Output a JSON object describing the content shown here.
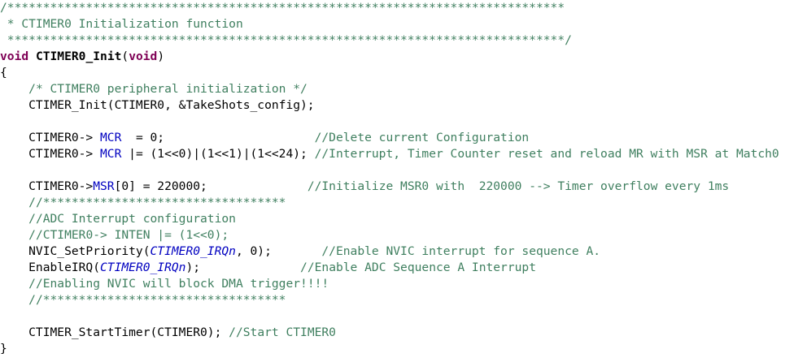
{
  "editor": {
    "lines": [
      {
        "name": "comment-header-top",
        "segments": [
          {
            "c": "cm",
            "t": "/******************************************************************************"
          }
        ]
      },
      {
        "name": "comment-header-title",
        "segments": [
          {
            "c": "cm",
            "t": " * CTIMER0 Initialization function"
          }
        ]
      },
      {
        "name": "comment-header-bottom",
        "segments": [
          {
            "c": "cm",
            "t": " ******************************************************************************/"
          }
        ]
      },
      {
        "name": "function-signature",
        "segments": [
          {
            "c": "kw",
            "t": "void"
          },
          {
            "c": "pl",
            "t": " "
          },
          {
            "c": "fnb",
            "t": "CTIMER0_Init"
          },
          {
            "c": "pl",
            "t": "("
          },
          {
            "c": "kw",
            "t": "void"
          },
          {
            "c": "pl",
            "t": ")"
          }
        ]
      },
      {
        "name": "open-brace",
        "segments": [
          {
            "c": "pl",
            "t": "{"
          }
        ]
      },
      {
        "name": "comment-peripheral-init",
        "segments": [
          {
            "c": "pl",
            "t": "    "
          },
          {
            "c": "cm",
            "t": "/* CTIMER0 peripheral initialization */"
          }
        ]
      },
      {
        "name": "ctimer-init-call",
        "segments": [
          {
            "c": "pl",
            "t": "    CTIMER_Init(CTIMER0, &TakeShots_config);"
          }
        ]
      },
      {
        "name": "blank-line",
        "segments": []
      },
      {
        "name": "mcr-clear",
        "segments": [
          {
            "c": "pl",
            "t": "    CTIMER0-> "
          },
          {
            "c": "fld",
            "t": "MCR"
          },
          {
            "c": "pl",
            "t": "  = 0;                     "
          },
          {
            "c": "cm",
            "t": "//Delete current Configuration"
          }
        ]
      },
      {
        "name": "mcr-set",
        "segments": [
          {
            "c": "pl",
            "t": "    CTIMER0-> "
          },
          {
            "c": "fld",
            "t": "MCR"
          },
          {
            "c": "pl",
            "t": " |= (1<<0)|(1<<1)|(1<<24); "
          },
          {
            "c": "cm",
            "t": "//Interrupt, Timer Counter reset and reload MR with MSR at Match0"
          }
        ]
      },
      {
        "name": "blank-line",
        "segments": []
      },
      {
        "name": "msr-set",
        "segments": [
          {
            "c": "pl",
            "t": "    CTIMER0->"
          },
          {
            "c": "fld",
            "t": "MSR"
          },
          {
            "c": "pl",
            "t": "[0] = 220000;              "
          },
          {
            "c": "cm",
            "t": "//Initialize MSR0 with  220000 --> Timer overflow every 1ms"
          }
        ]
      },
      {
        "name": "comment-separator",
        "segments": [
          {
            "c": "pl",
            "t": "    "
          },
          {
            "c": "cm",
            "t": "//**********************************"
          }
        ]
      },
      {
        "name": "comment-adc-interrupt",
        "segments": [
          {
            "c": "pl",
            "t": "    "
          },
          {
            "c": "cm",
            "t": "//ADC Interrupt configuration"
          }
        ]
      },
      {
        "name": "comment-inten",
        "segments": [
          {
            "c": "pl",
            "t": "    "
          },
          {
            "c": "cm",
            "t": "//CTIMER0-> INTEN |= (1<<0);"
          }
        ]
      },
      {
        "name": "nvic-set-priority",
        "segments": [
          {
            "c": "pl",
            "t": "    NVIC_SetPriority("
          },
          {
            "c": "it",
            "t": "CTIMER0_IRQn"
          },
          {
            "c": "pl",
            "t": ", 0);       "
          },
          {
            "c": "cm",
            "t": "//Enable NVIC interrupt for sequence A."
          }
        ]
      },
      {
        "name": "enable-irq",
        "segments": [
          {
            "c": "pl",
            "t": "    EnableIRQ("
          },
          {
            "c": "it",
            "t": "CTIMER0_IRQn"
          },
          {
            "c": "pl",
            "t": ");              "
          },
          {
            "c": "cm",
            "t": "//Enable ADC Sequence A Interrupt"
          }
        ]
      },
      {
        "name": "comment-nvic-dma",
        "segments": [
          {
            "c": "pl",
            "t": "    "
          },
          {
            "c": "cm",
            "t": "//Enabling NVIC will block DMA trigger!!!!"
          }
        ]
      },
      {
        "name": "comment-separator",
        "segments": [
          {
            "c": "pl",
            "t": "    "
          },
          {
            "c": "cm",
            "t": "//**********************************"
          }
        ]
      },
      {
        "name": "blank-line",
        "segments": []
      },
      {
        "name": "start-timer",
        "segments": [
          {
            "c": "pl",
            "t": "    CTIMER_StartTimer(CTIMER0); "
          },
          {
            "c": "cm",
            "t": "//Start CTIMER0"
          }
        ]
      },
      {
        "name": "close-brace",
        "segments": [
          {
            "c": "pl",
            "t": "}"
          }
        ]
      }
    ]
  }
}
